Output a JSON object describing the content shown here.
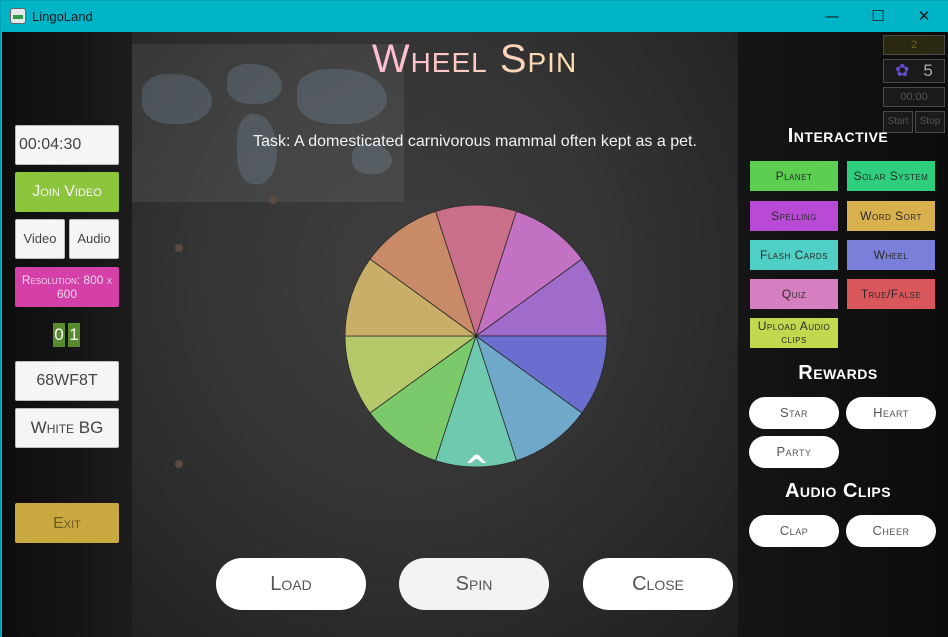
{
  "window": {
    "title": "LingoLand",
    "minimize": "—",
    "maximize": "☐",
    "close": "✕"
  },
  "left": {
    "timer": "00:04:30",
    "join_video": "Join Video",
    "video": "Video",
    "audio": "Audio",
    "resolution": "Resolution: 800 x 600",
    "digit1": "0",
    "digit2": "1",
    "room_code": "68WF8T",
    "white_bg": "White BG",
    "exit": "Exit"
  },
  "game": {
    "title": "Wheel Spin",
    "task": "Task: A domesticated carnivorous mammal often kept as a pet.",
    "pointer": "^",
    "load": "Load",
    "spin": "Spin",
    "close": "Close",
    "wheel_colors": [
      "#c96f89",
      "#c271c3",
      "#a06ccc",
      "#6a6fcf",
      "#6fa8c9",
      "#6fc9ae",
      "#7ac96a",
      "#b5c96b",
      "#c9ae68",
      "#c98a68"
    ]
  },
  "right": {
    "mini_score": "2",
    "mini_count": "5",
    "mini_time": "00:00",
    "mini_start": "Start",
    "mini_stop": "Stop",
    "interactive_heading": "Interactive",
    "interactive": [
      {
        "label": "Planet",
        "color": "#5ccf52"
      },
      {
        "label": "Solar System",
        "color": "#2ecf7c"
      },
      {
        "label": "Spelling",
        "color": "#b94ad6"
      },
      {
        "label": "Word Sort",
        "color": "#d9b04e"
      },
      {
        "label": "Flash Cards",
        "color": "#4fcfc6"
      },
      {
        "label": "Wheel",
        "color": "#7a7fd9"
      },
      {
        "label": "Quiz",
        "color": "#d67fc0"
      },
      {
        "label": "True/False",
        "color": "#d9575a"
      },
      {
        "label": "Upload Audio clips",
        "color": "#c0d94e"
      }
    ],
    "rewards_heading": "Rewards",
    "rewards": [
      "Star",
      "Heart",
      "Party"
    ],
    "audio_heading": "Audio Clips",
    "audio_clips": [
      "Clap",
      "Cheer"
    ]
  }
}
